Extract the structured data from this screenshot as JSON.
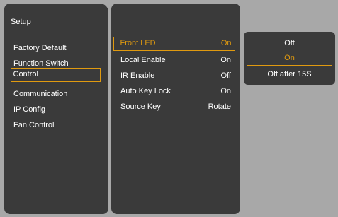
{
  "setup": {
    "title": "Setup",
    "items": [
      {
        "label": "Factory Default"
      },
      {
        "label": "Function Switch"
      },
      {
        "label": "Control"
      },
      {
        "label": "Communication"
      },
      {
        "label": "IP Config"
      },
      {
        "label": "Fan Control"
      }
    ]
  },
  "control_settings": [
    {
      "label": "Front LED",
      "value": "On"
    },
    {
      "label": "Local Enable",
      "value": "On"
    },
    {
      "label": "IR Enable",
      "value": "Off"
    },
    {
      "label": "Auto Key Lock",
      "value": "On"
    },
    {
      "label": "Source Key",
      "value": "Rotate"
    }
  ],
  "front_led_options": [
    {
      "label": "Off"
    },
    {
      "label": "On"
    },
    {
      "label": "Off after 15S"
    }
  ],
  "colors": {
    "background": "#a8a8a8",
    "panel": "#3a3a3a",
    "accent": "#e09a10",
    "text": "#ffffff"
  }
}
